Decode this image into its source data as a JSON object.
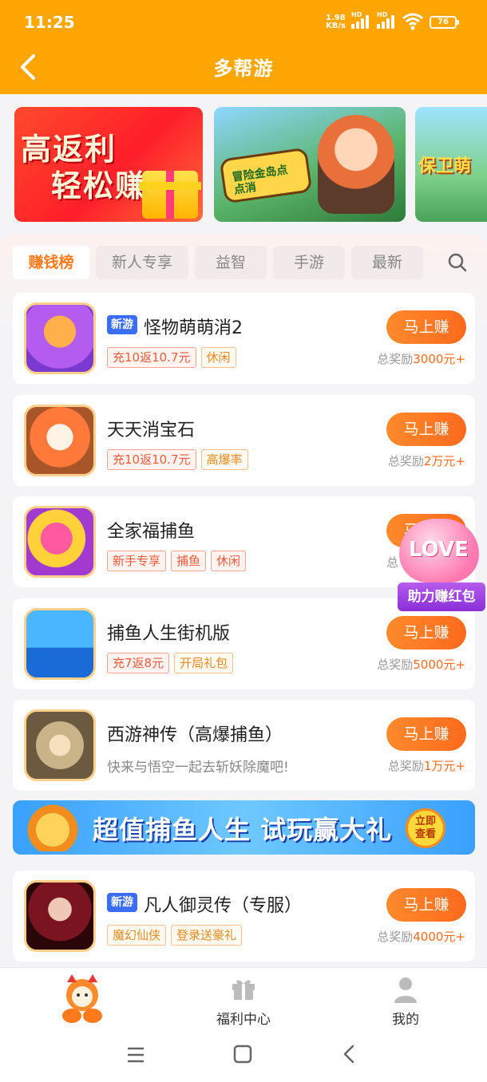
{
  "status_bar": {
    "time": "11:25",
    "net_speed_value": "1.98",
    "net_speed_unit": "KB/s",
    "hd1": "HD",
    "hd2": "HD",
    "battery": "76"
  },
  "header": {
    "title": "多帮游",
    "back_icon": "chevron-left-icon"
  },
  "banners": [
    {
      "line1": "高返利",
      "line2": "轻松赚"
    },
    {
      "logo_text": "冒险金岛点点消"
    },
    {
      "text": "保卫萌"
    }
  ],
  "tabs": [
    {
      "label": "赚钱榜",
      "active": true
    },
    {
      "label": "新人专享",
      "active": false
    },
    {
      "label": "益智",
      "active": false
    },
    {
      "label": "手游",
      "active": false
    },
    {
      "label": "最新",
      "active": false
    }
  ],
  "games": [
    {
      "name": "怪物萌萌消2",
      "new_badge": "新游",
      "tags": [
        {
          "text": "充10返10.7元",
          "style": "red"
        },
        {
          "text": "休闲",
          "style": "orange"
        }
      ],
      "button": "马上赚",
      "reward_prefix": "总奖励",
      "reward_value": "3000元+"
    },
    {
      "name": "天天消宝石",
      "new_badge": "",
      "tags": [
        {
          "text": "充10返10.7元",
          "style": "red"
        },
        {
          "text": "高爆率",
          "style": "orange"
        }
      ],
      "button": "马上赚",
      "reward_prefix": "总奖励",
      "reward_value": "2万元+"
    },
    {
      "name": "全家福捕鱼",
      "new_badge": "",
      "tags": [
        {
          "text": "新手专享",
          "style": "red"
        },
        {
          "text": "捕鱼",
          "style": "red"
        },
        {
          "text": "休闲",
          "style": "red"
        }
      ],
      "button": "马上赚",
      "reward_prefix": "总",
      "reward_value": ""
    },
    {
      "name": "捕鱼人生街机版",
      "new_badge": "",
      "tags": [
        {
          "text": "充7返8元",
          "style": "red"
        },
        {
          "text": "开局礼包",
          "style": "orange"
        }
      ],
      "button": "马上赚",
      "reward_prefix": "总奖励",
      "reward_value": "5000元+"
    },
    {
      "name": "西游神传（高爆捕鱼）",
      "new_badge": "",
      "desc": "快来与悟空一起去斩妖除魔吧!",
      "button": "马上赚",
      "reward_prefix": "总奖励",
      "reward_value": "1万元+"
    },
    {
      "name": "凡人御灵传（专服）",
      "new_badge": "新游",
      "tags": [
        {
          "text": "魔幻仙侠",
          "style": "orange"
        },
        {
          "text": "登录送豪礼",
          "style": "orange"
        }
      ],
      "button": "马上赚",
      "reward_prefix": "总奖励",
      "reward_value": "4000元+"
    }
  ],
  "ad_banner": {
    "text": "超值捕鱼人生 试玩赢大礼",
    "button_line1": "立即",
    "button_line2": "查看"
  },
  "float_promo": {
    "heart_text": "LOVE",
    "label": "助力赚红包"
  },
  "bottom_nav": [
    {
      "label": "",
      "icon": "mascot-icon"
    },
    {
      "label": "福利中心",
      "icon": "gift-icon"
    },
    {
      "label": "我的",
      "icon": "user-icon"
    }
  ],
  "colors": {
    "brand": "#ffa604",
    "accent": "#ff6a1c",
    "new_badge": "#3a6cf4"
  }
}
